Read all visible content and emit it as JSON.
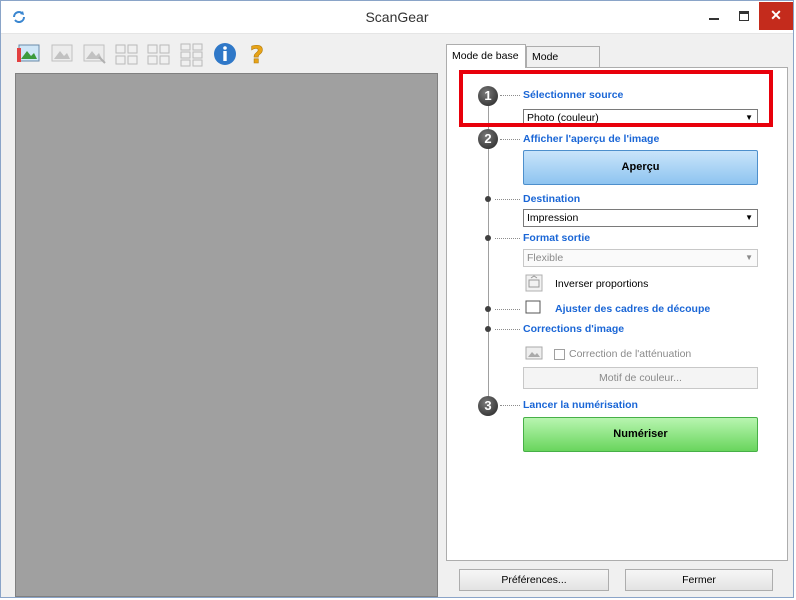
{
  "window": {
    "title": "ScanGear",
    "minimize_icon": "minimize-icon",
    "maximize_icon": "maximize-icon",
    "close_icon": "close-icon",
    "close_label": "✕"
  },
  "toolbar": {
    "icons": [
      "crop-photo-icon",
      "image-icon",
      "image-select-icon",
      "thumbnail-grid-icon",
      "thumbnail-grid-icon",
      "thumbnail-grid-icon",
      "info-icon",
      "help-icon"
    ]
  },
  "tabs": {
    "basic": "Mode de base",
    "advanced": "Mode avancé"
  },
  "steps": {
    "step1_number": "1",
    "step2_number": "2",
    "step3_number": "3"
  },
  "select_source": {
    "label": "Sélectionner source",
    "value": "Photo (couleur)"
  },
  "preview": {
    "label": "Afficher l'aperçu de l'image",
    "button": "Aperçu"
  },
  "destination": {
    "label": "Destination",
    "value": "Impression"
  },
  "output_format": {
    "label": "Format sortie",
    "value": "Flexible",
    "invert_label": "Inverser proportions"
  },
  "crop": {
    "label": "Ajuster des cadres de découpe"
  },
  "corrections": {
    "label": "Corrections d'image",
    "fading_label": "Correction de l'atténuation",
    "color_pattern_button": "Motif de couleur..."
  },
  "scan": {
    "label": "Lancer la numérisation",
    "button": "Numériser"
  },
  "bottom": {
    "preferences": "Préférences...",
    "close": "Fermer"
  },
  "colors": {
    "accent": "#1a66d6",
    "highlight": "#e8000b",
    "preview_bg": "#a0a0a0"
  }
}
